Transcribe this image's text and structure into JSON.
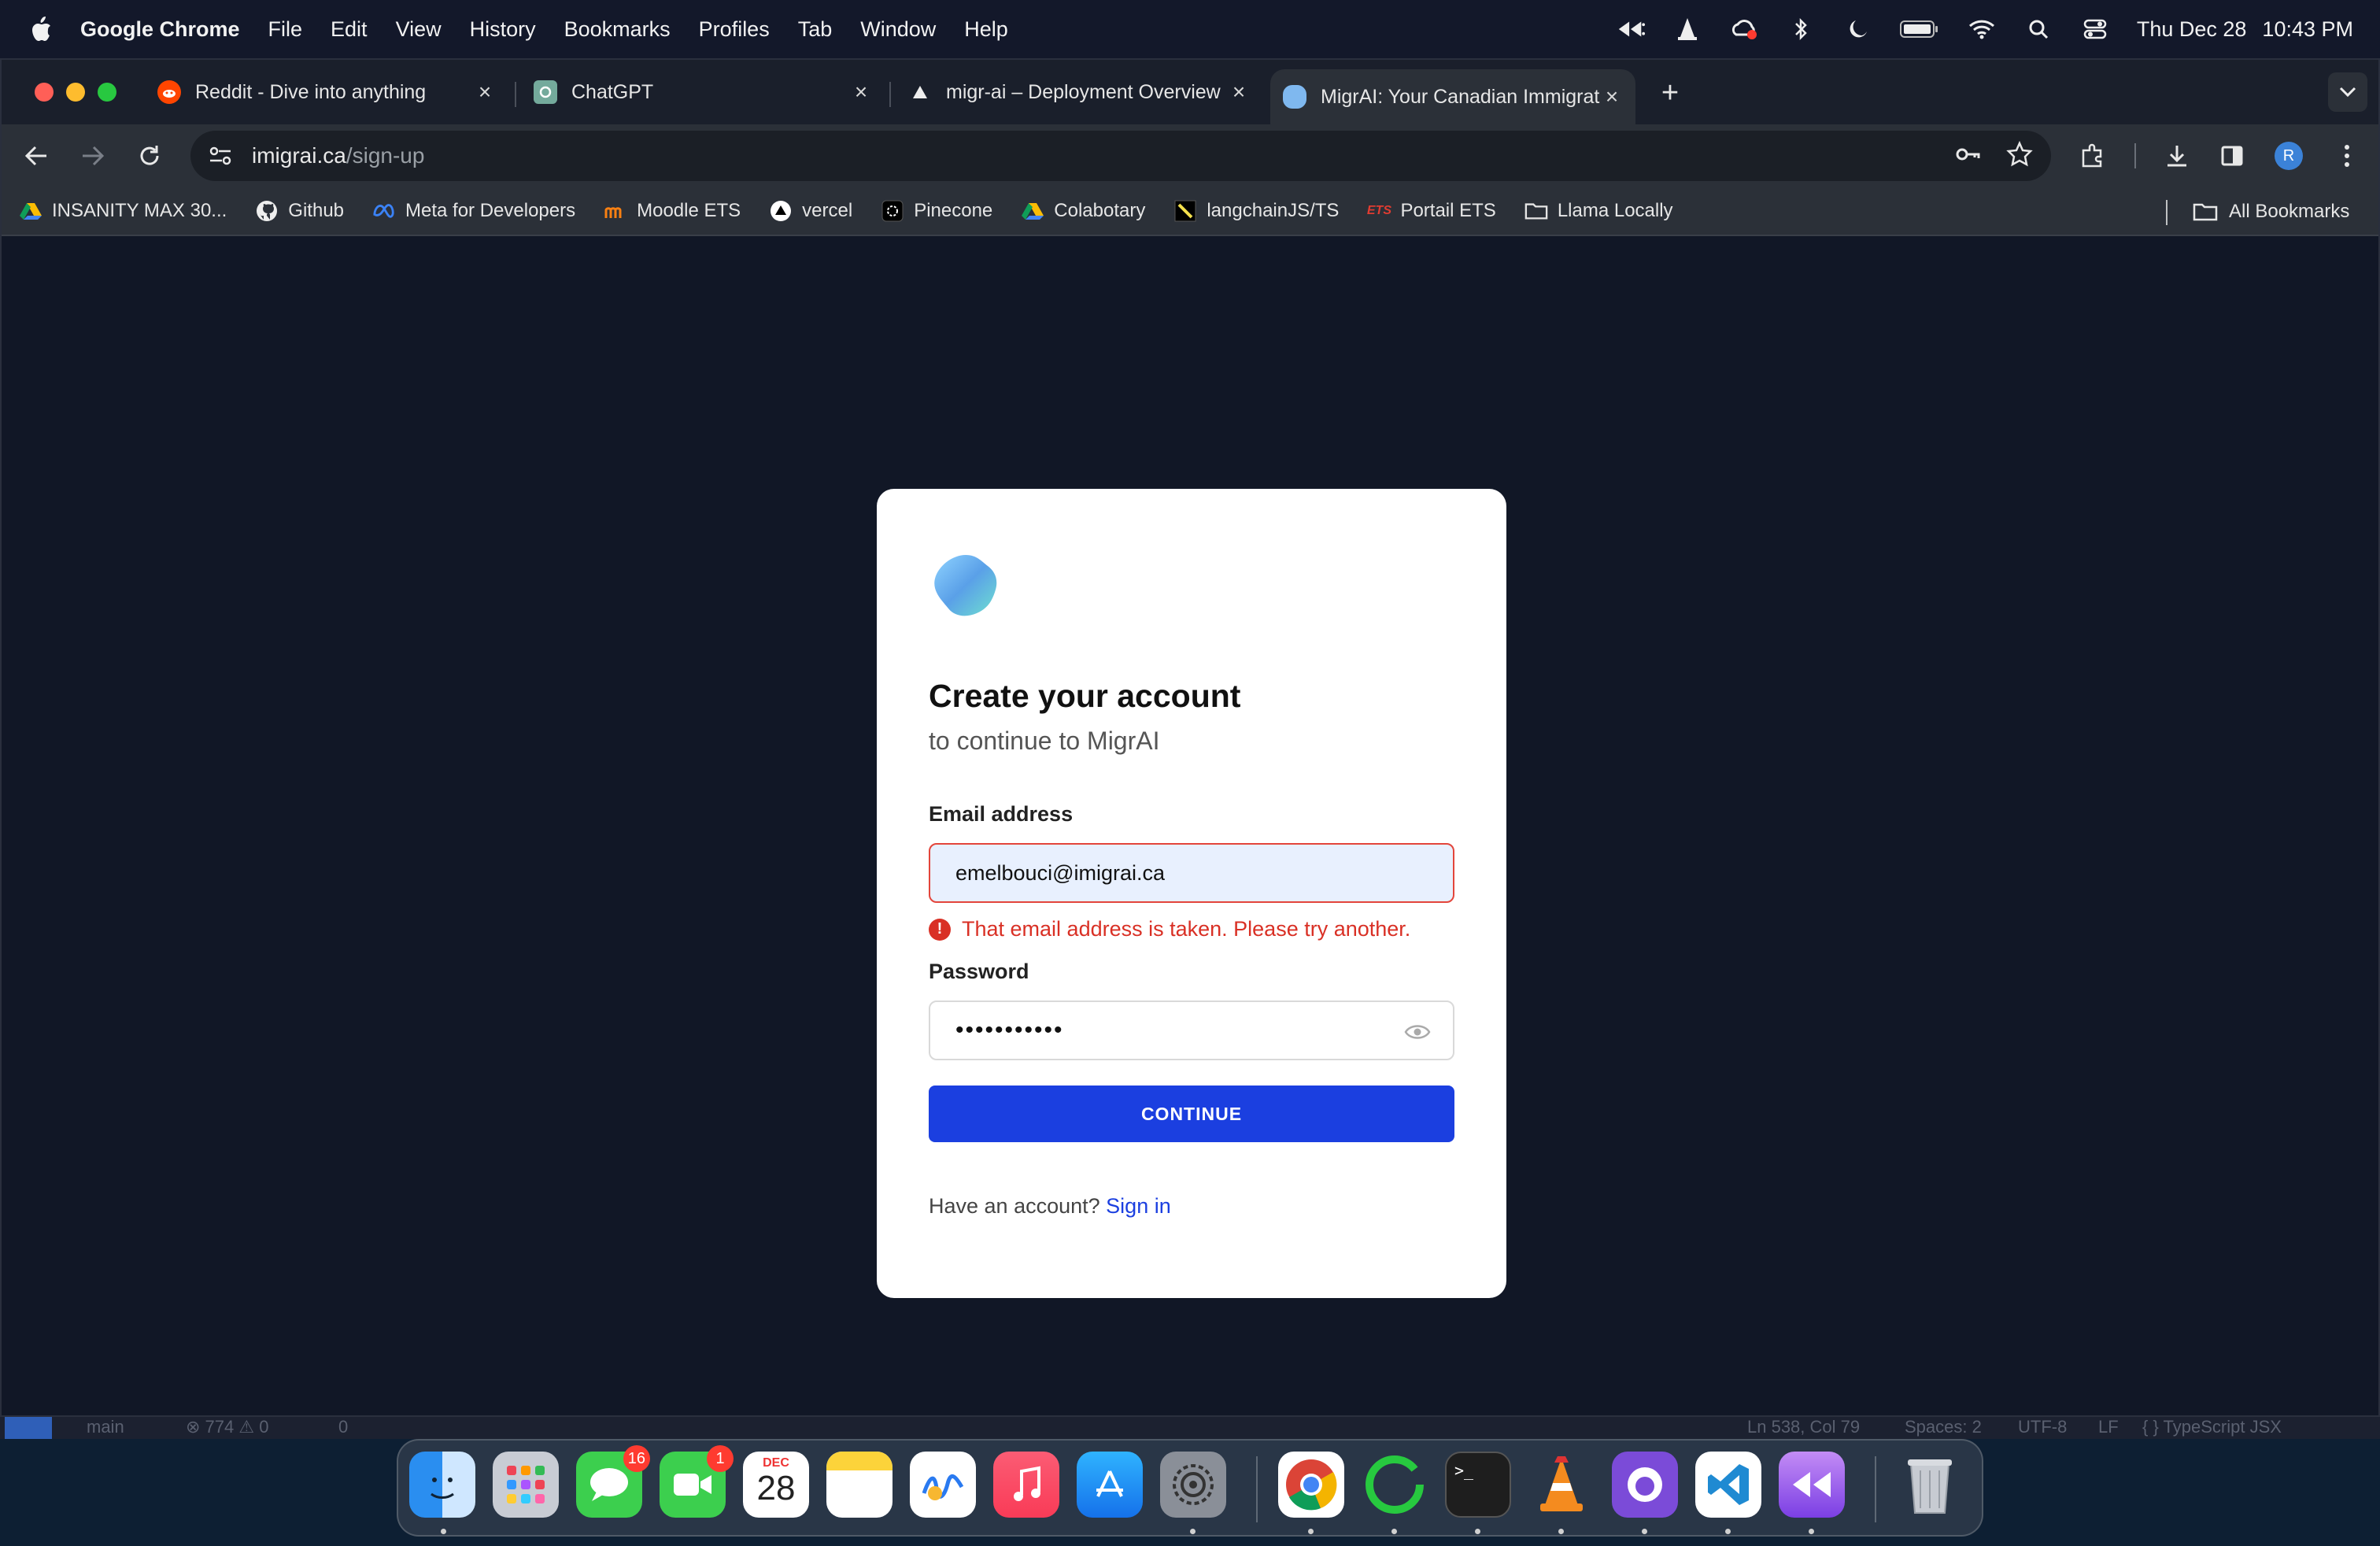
{
  "menubar": {
    "app_name": "Google Chrome",
    "menus": [
      "File",
      "Edit",
      "View",
      "History",
      "Bookmarks",
      "Profiles",
      "Tab",
      "Window",
      "Help"
    ],
    "date": "Thu Dec 28",
    "time": "10:43 PM"
  },
  "tabs": [
    {
      "title": "Reddit - Dive into anything",
      "icon": "reddit-icon"
    },
    {
      "title": "ChatGPT",
      "icon": "chatgpt-icon"
    },
    {
      "title": "migr-ai – Deployment Overview",
      "icon": "vercel-icon"
    },
    {
      "title": "MigrAI: Your Canadian Immigration",
      "icon": "migrai-icon",
      "active": true
    }
  ],
  "omnibox": {
    "domain": "imigrai.ca",
    "path": "/sign-up"
  },
  "profile_initial": "R",
  "bookmarks": [
    {
      "label": "INSANITY MAX 30...",
      "icon": "google-drive-icon"
    },
    {
      "label": "Github",
      "icon": "github-icon"
    },
    {
      "label": "Meta for Developers",
      "icon": "meta-icon"
    },
    {
      "label": "Moodle ETS",
      "icon": "moodle-icon"
    },
    {
      "label": "vercel",
      "icon": "vercel-icon"
    },
    {
      "label": "Pinecone",
      "icon": "pinecone-icon"
    },
    {
      "label": "Colabotary",
      "icon": "google-drive-icon"
    },
    {
      "label": "langchainJS/TS",
      "icon": "langchain-icon"
    },
    {
      "label": "Portail ETS",
      "icon": "ets-icon"
    },
    {
      "label": "Llama Locally",
      "icon": "folder-icon"
    }
  ],
  "all_bookmarks_label": "All Bookmarks",
  "signup": {
    "title": "Create your account",
    "subtitle": "to continue to MigrAI",
    "email_label": "Email address",
    "email_value": "emelbouci@imigrai.ca",
    "error_text": "That email address is taken. Please try another.",
    "password_label": "Password",
    "password_value": "•••••••••••",
    "continue_label": "CONTINUE",
    "footer_text": "Have an account?",
    "signin_link": "Sign in"
  },
  "vscode_status": {
    "branch": "main",
    "problems": "⊗ 774 ⚠ 0",
    "ports": "0",
    "cursor": "Ln 538, Col 79",
    "spaces": "Spaces: 2",
    "encoding": "UTF-8",
    "eol": "LF",
    "language": "{ } TypeScript JSX"
  },
  "dock": {
    "messages_badge": "16",
    "facetime_badge": "1",
    "calendar_month": "DEC",
    "calendar_day": "28"
  },
  "colors": {
    "accent": "#1b3fe0",
    "error": "#d93025",
    "page_bg": "#111726"
  }
}
